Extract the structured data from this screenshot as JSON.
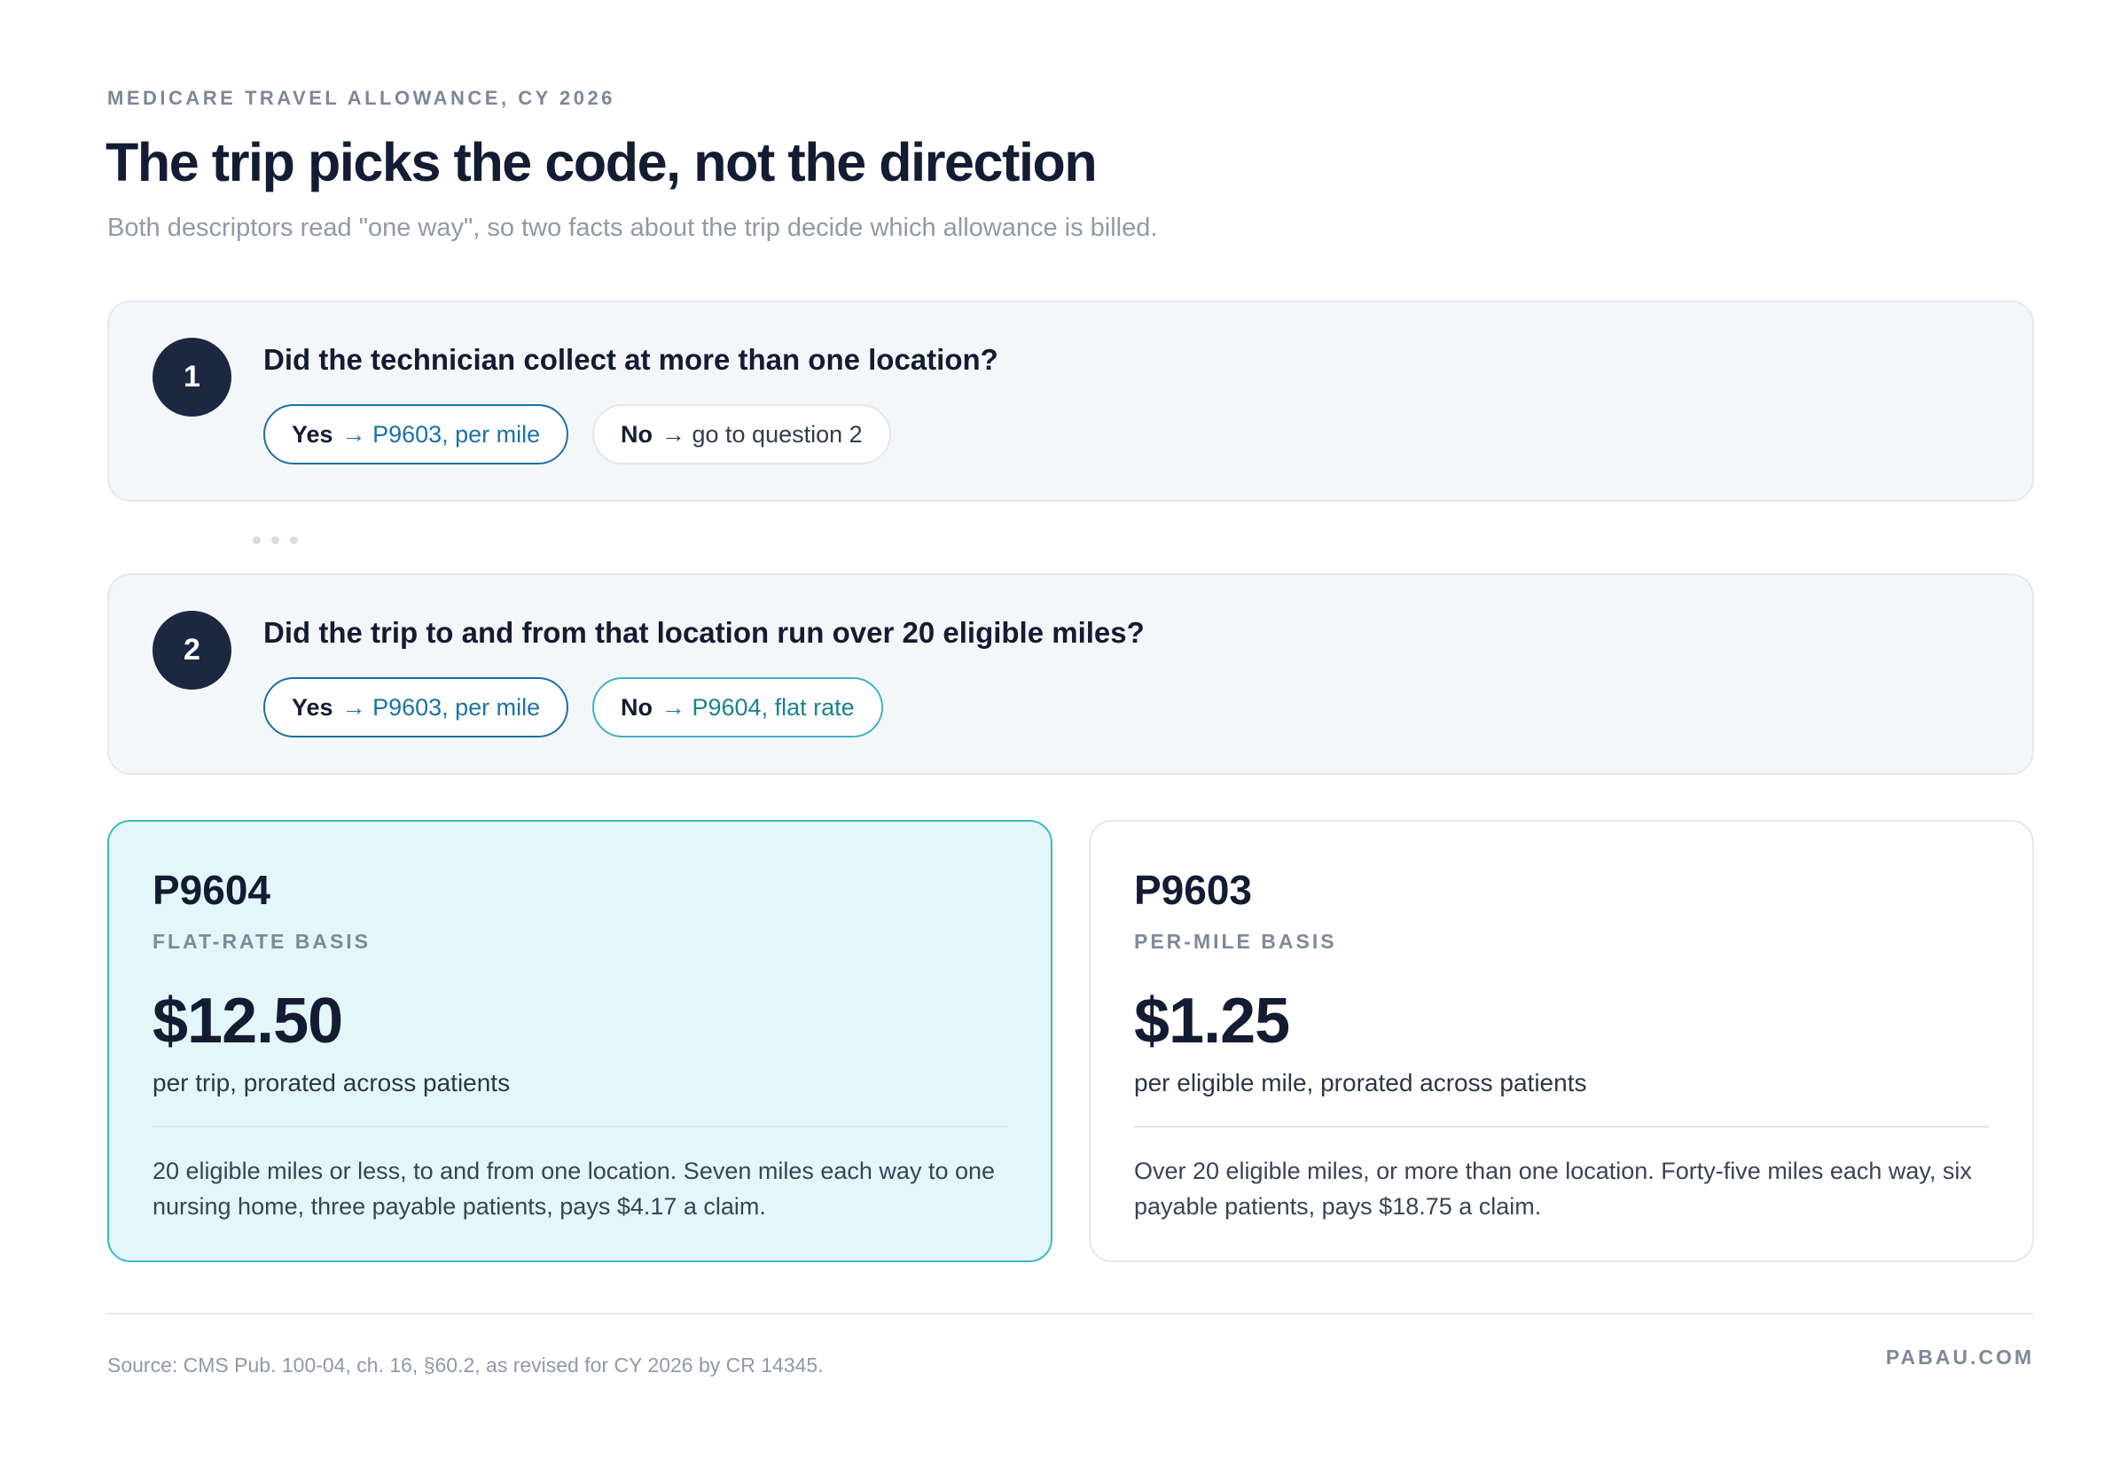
{
  "header": {
    "eyebrow": "MEDICARE TRAVEL ALLOWANCE, CY 2026",
    "title": "The trip picks the code, not the direction",
    "subtitle": "Both descriptors read \"one way\", so two facts about the trip decide which allowance is billed."
  },
  "questions": [
    {
      "number": "1",
      "text": "Did the technician collect at more than one location?",
      "yes": {
        "label": "Yes",
        "outcome": "→ P9603, per mile"
      },
      "no": {
        "label": "No",
        "outcome": "→ go to question 2"
      }
    },
    {
      "number": "2",
      "text": "Did the trip to and from that location run over 20 eligible miles?",
      "yes": {
        "label": "Yes",
        "outcome": "→ P9603, per mile"
      },
      "no": {
        "label": "No",
        "outcome": "→ P9604, flat rate"
      }
    }
  ],
  "rates": [
    {
      "code": "P9604",
      "basis": "FLAT-RATE BASIS",
      "price": "$12.50",
      "unit": "per trip, prorated across patients",
      "description": "20 eligible miles or less, to and from one location. Seven miles each way to one nursing home, three payable patients, pays $4.17 a claim."
    },
    {
      "code": "P9603",
      "basis": "PER-MILE BASIS",
      "price": "$1.25",
      "unit": "per eligible mile, prorated across patients",
      "description": "Over 20 eligible miles, or more than one location. Forty-five miles each way, six payable patients, pays $18.75 a claim."
    }
  ],
  "footer": {
    "source": "Source: CMS Pub. 100-04, ch. 16, §60.2, as revised for CY 2026 by CR 14345.",
    "brand": "PABAU.COM"
  },
  "colors": {
    "navy": "#1c2740",
    "blue_accent": "#1b6fa3",
    "teal_accent": "#3cb8c8",
    "highlight_card": "#e3f6fa"
  }
}
